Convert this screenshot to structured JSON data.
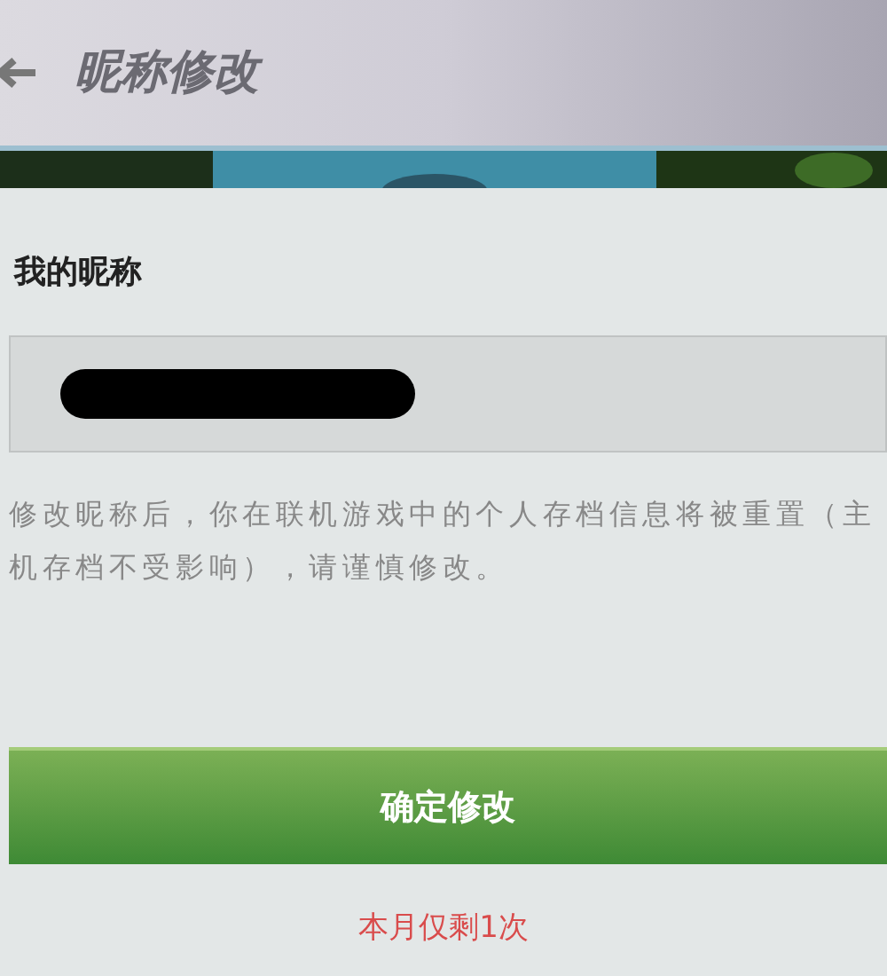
{
  "header": {
    "title": "昵称修改"
  },
  "nickname_section": {
    "label": "我的昵称",
    "redacted": true
  },
  "notice": "修改昵称后，你在联机游戏中的个人存档信息将被重置（主机存档不受影响），请谨慎修改。",
  "confirm_button": {
    "label": "确定修改"
  },
  "remaining_note": "本月仅剩1次"
}
